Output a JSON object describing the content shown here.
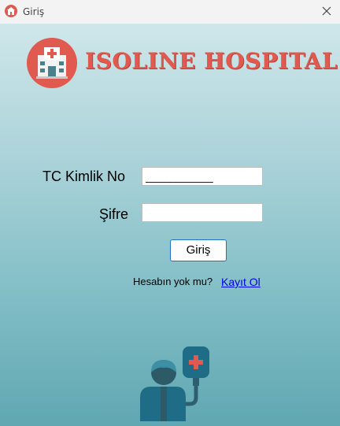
{
  "window": {
    "title": "Giriş",
    "close_label": "close"
  },
  "brand": {
    "name": "ISOLINE HOSPITAL",
    "color": "#e05a4f"
  },
  "form": {
    "tc_label": "TC Kimlik No",
    "tc_value": "___________",
    "password_label": "Şifre",
    "password_value": "",
    "login_button": "Giriş"
  },
  "footer": {
    "no_account_text": "Hesabın yok mu?",
    "register_link": "Kayıt Ol"
  },
  "colors": {
    "accent": "#1e73c8",
    "link": "#0000ee",
    "background_bottom": "#60a7b1"
  },
  "icons": [
    "hospital-app-icon",
    "close-icon",
    "hospital-logo-icon",
    "doctor-stethoscope-icon"
  ]
}
